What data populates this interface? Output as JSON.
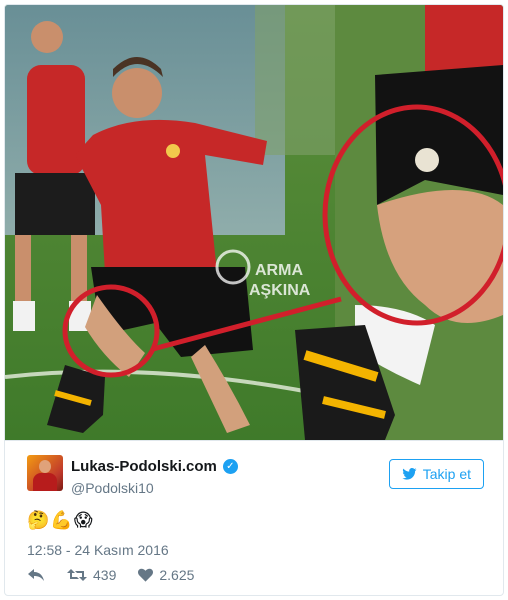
{
  "photo": {
    "watermark_line1": "ARMA",
    "watermark_line2": "AŞKINA"
  },
  "tweet": {
    "display_name": "Lukas-Podolski.com",
    "verified_glyph": "✓",
    "handle": "@Podolski10",
    "follow_label": "Takip et",
    "text": "🤔💪😱",
    "timestamp": "12:58 - 24 Kasım 2016",
    "retweets": "439",
    "likes": "2.625"
  },
  "icons": {
    "follow": "twitter-bird-icon",
    "reply": "reply-icon",
    "retweet": "retweet-icon",
    "like": "heart-icon"
  },
  "colors": {
    "accent": "#1da1f2",
    "name": "#14171a",
    "muted": "#657786",
    "border": "#e1e8ed",
    "highlight_circle": "#d11f2b",
    "jersey_red": "#c62828"
  }
}
